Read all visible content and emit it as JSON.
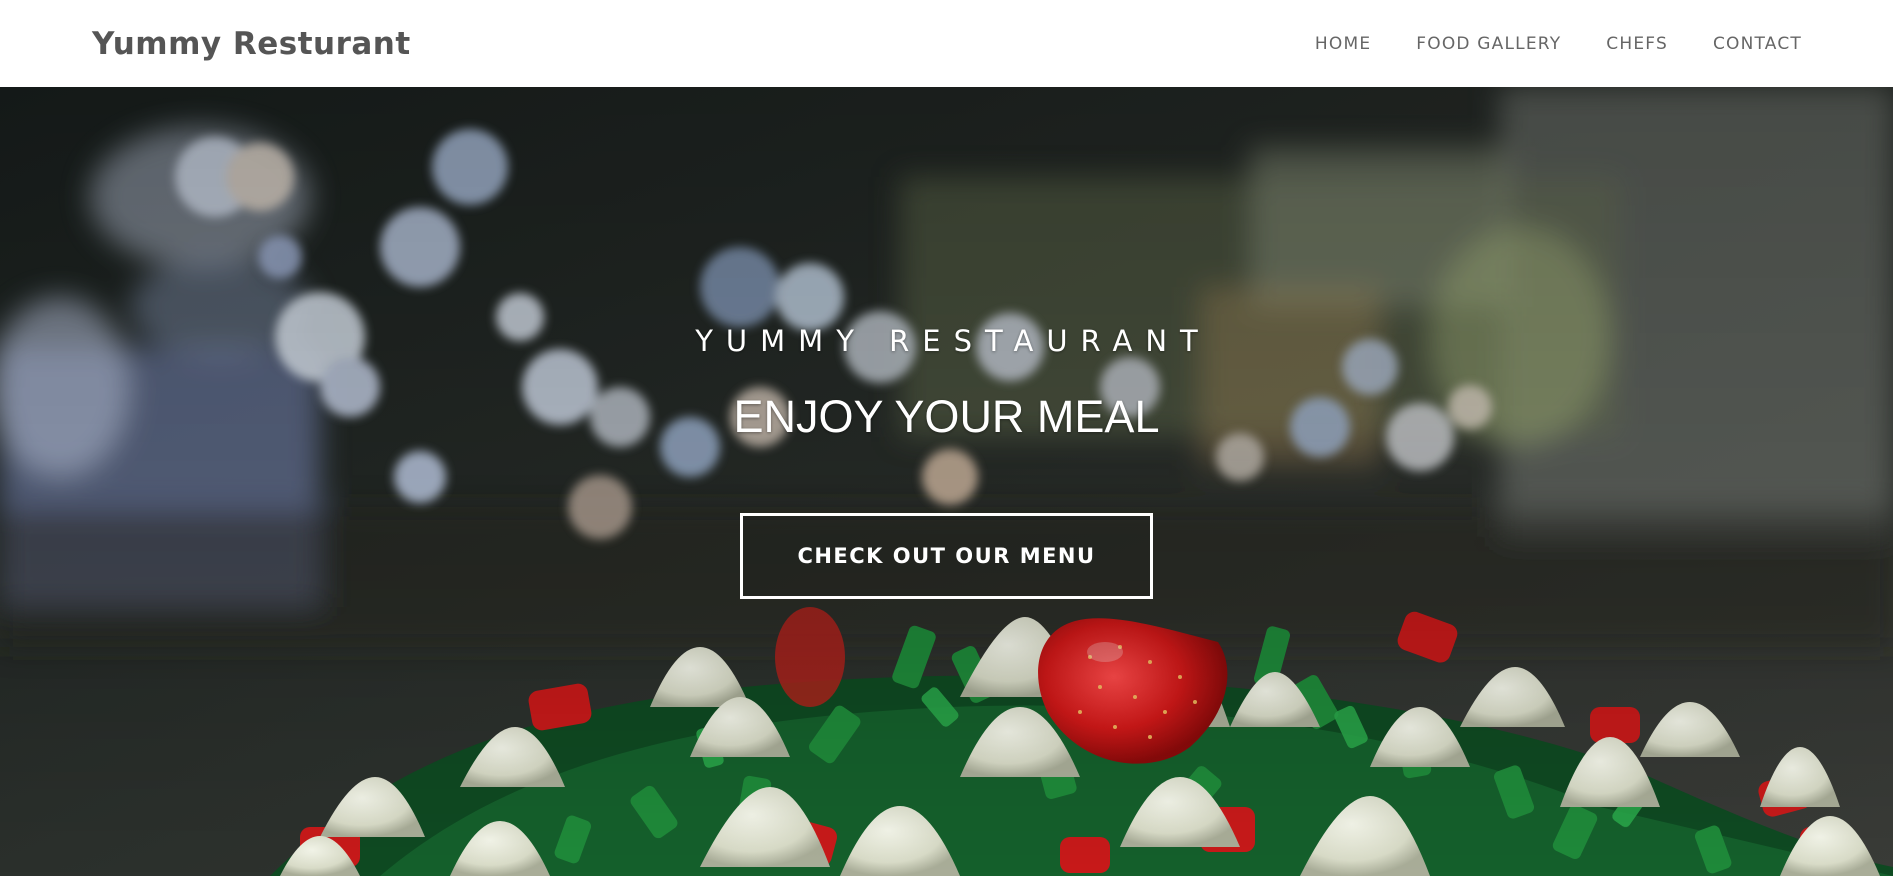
{
  "navbar": {
    "brand": "Yummy Resturant",
    "links": [
      "HOME",
      "FOOD GALLERY",
      "CHEFS",
      "CONTACT"
    ]
  },
  "hero": {
    "subtitle": "YUMMY RESTAURANT",
    "headline": "ENJOY YOUR MEAL",
    "cta_label": "CHECK OUT OUR MENU"
  },
  "colors": {
    "navbar_bg": "#ffffff",
    "brand_text": "#555555",
    "nav_text": "#666666",
    "hero_text": "#ffffff"
  }
}
